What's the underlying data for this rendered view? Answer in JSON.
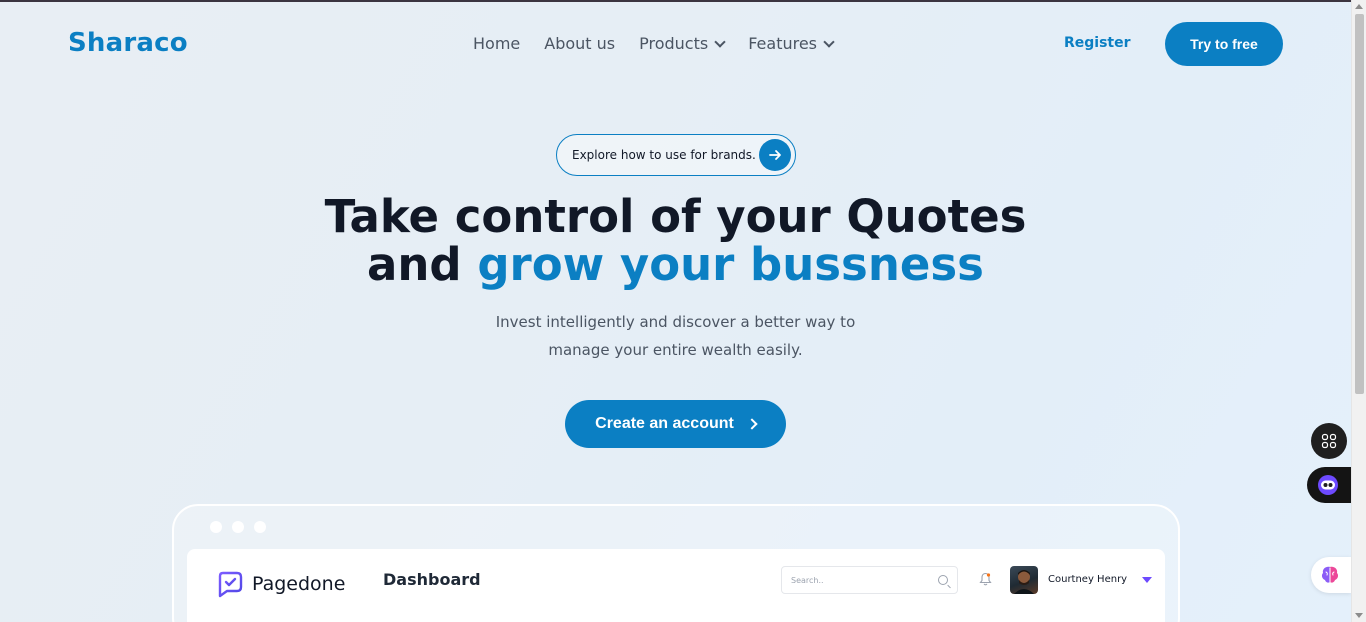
{
  "header": {
    "logo": "Sharaco",
    "nav": [
      {
        "label": "Home"
      },
      {
        "label": "About us"
      },
      {
        "label": "Products"
      },
      {
        "label": "Features"
      }
    ],
    "register_label": "Register",
    "try_label": "Try to free"
  },
  "hero": {
    "explore_label": "Explore how to use for brands.",
    "headline_line1": "Take control of your Quotes",
    "headline_line2_prefix": "and ",
    "headline_line2_accent": "grow your bussness",
    "subtext_line1": "Invest intelligently and discover a better way to",
    "subtext_line2": "manage your entire wealth easily.",
    "cta_label": "Create an account"
  },
  "dashboard_preview": {
    "brand": "Pagedone",
    "title": "Dashboard",
    "search_placeholder": "Search..",
    "user_name": "Courtney Henry"
  },
  "colors": {
    "accent": "#0b7fc3",
    "text_dark": "#111827",
    "muted": "#4b5563"
  },
  "icons": [
    "chevron-down-icon",
    "arrow-right-icon",
    "chevron-right-icon",
    "search-icon",
    "bell-icon",
    "grid-icon",
    "bot-icon",
    "brain-icon"
  ]
}
